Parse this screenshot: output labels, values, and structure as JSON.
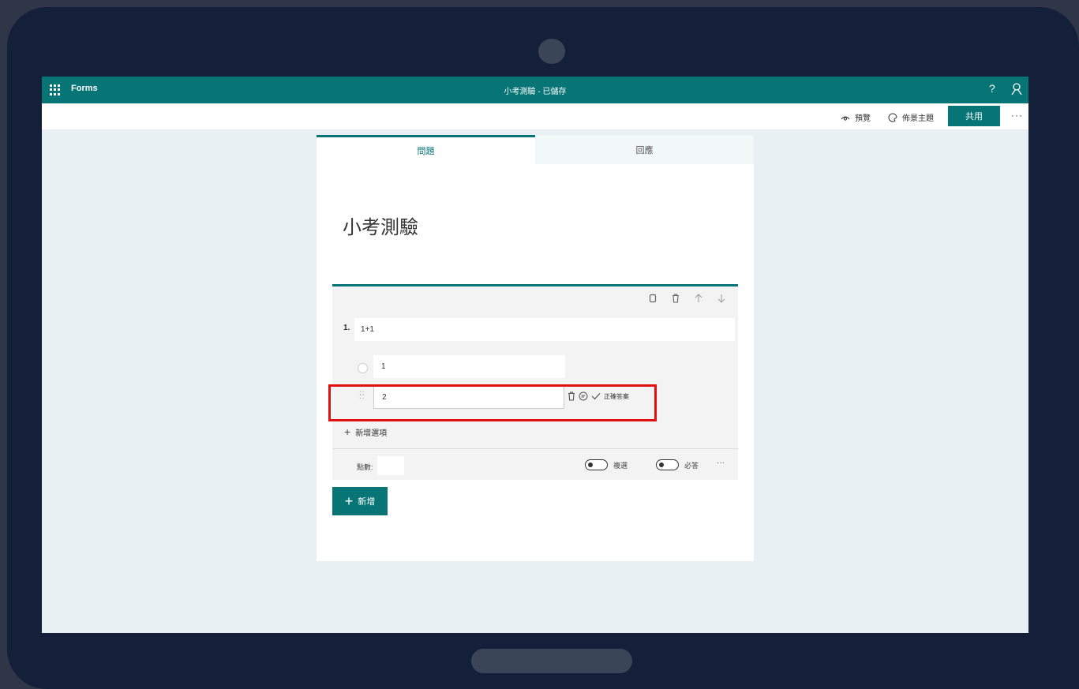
{
  "header": {
    "app_name": "Forms",
    "doc_title": "小考測驗 - 已儲存",
    "help_label": "?"
  },
  "commandbar": {
    "preview_label": "預覽",
    "theme_label": "佈景主題",
    "share_label": "共用",
    "more_label": "···"
  },
  "tabs": [
    {
      "label": "問題",
      "active": true
    },
    {
      "label": "回應",
      "active": false
    }
  ],
  "form": {
    "title": "小考測驗",
    "add_new_label": "新增"
  },
  "question": {
    "number": "1.",
    "text": "1+1",
    "options": [
      {
        "value": "1"
      },
      {
        "value": "2"
      }
    ],
    "correct_answer_label": "正確答案",
    "add_option_label": "新增選項",
    "points_label": "點數:",
    "points_value": "",
    "multiple_answers_label": "複選",
    "required_label": "必答",
    "more_label": "···"
  },
  "colors": {
    "accent": "#077475",
    "highlight": "#e01010",
    "device_frame": "#14203a",
    "canvas": "#e8f0f3"
  }
}
